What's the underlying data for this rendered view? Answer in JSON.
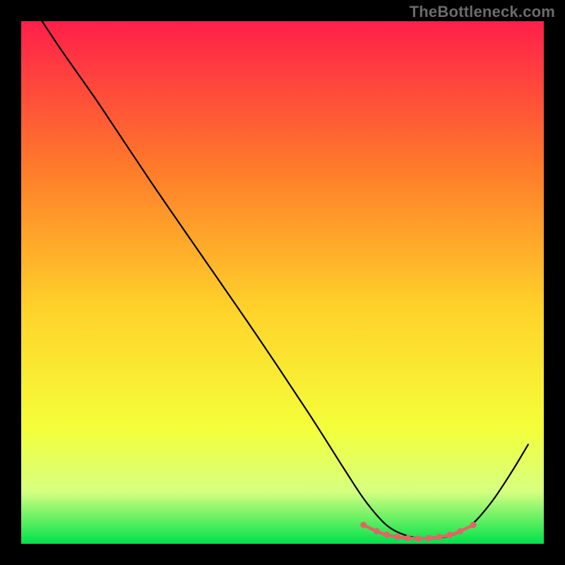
{
  "watermark": "TheBottleneck.com",
  "colors": {
    "background": "#000000",
    "gradient_top": "#ff1f4a",
    "gradient_upper_mid": "#ff7a2a",
    "gradient_mid": "#ffd22a",
    "gradient_lower_mid": "#f4ff3a",
    "gradient_low": "#d6ff80",
    "gradient_bottom": "#00e24a",
    "curve": "#000000",
    "markers": "#e06666"
  },
  "chart_data": {
    "type": "line",
    "title": "",
    "xlabel": "",
    "ylabel": "",
    "xlim": [
      0,
      100
    ],
    "ylim": [
      0,
      100
    ],
    "series": [
      {
        "name": "bottleneck-curve",
        "x": [
          4,
          8,
          15,
          25,
          35,
          45,
          55,
          62,
          66,
          70,
          74,
          78,
          82,
          86,
          90,
          94,
          97
        ],
        "values": [
          100,
          94,
          84,
          69,
          54.5,
          40,
          25,
          14,
          8,
          3.5,
          1.5,
          1.0,
          1.5,
          3.5,
          8,
          14,
          19
        ]
      }
    ],
    "markers": {
      "name": "highlighted-range",
      "x": [
        65.5,
        68,
        70,
        72,
        74,
        76,
        78,
        80,
        82,
        84,
        86.5
      ],
      "values": [
        3.6,
        2.4,
        1.7,
        1.3,
        1.1,
        1.0,
        1.1,
        1.3,
        1.7,
        2.4,
        3.6
      ]
    }
  }
}
